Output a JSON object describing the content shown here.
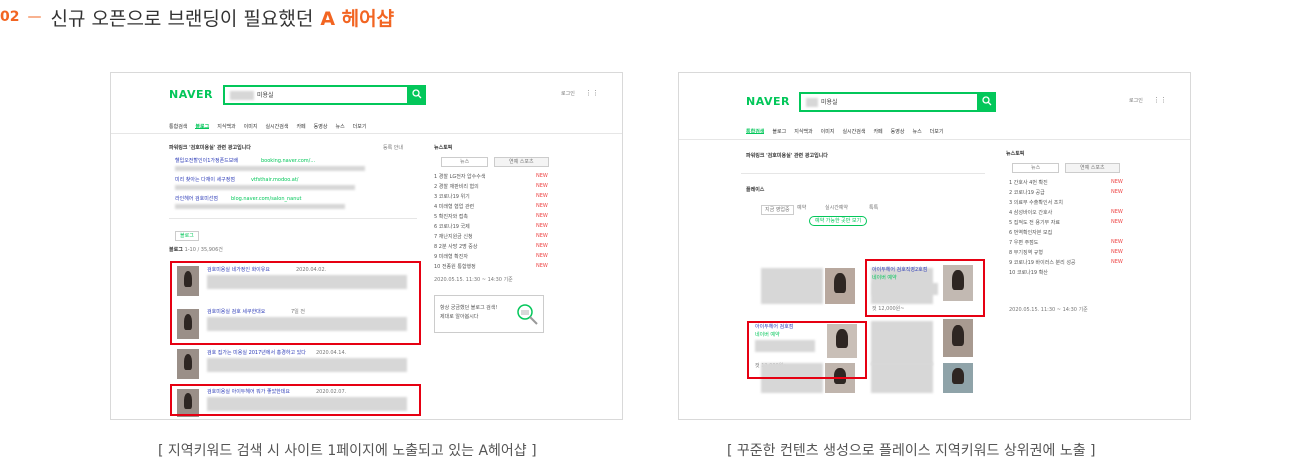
{
  "heading": {
    "number": "02",
    "dash": "—",
    "text": "신규 오픈으로 브랜딩이 필요했던",
    "accent": "A 헤어샵"
  },
  "captions": {
    "left": "[ 지역키워드 검색 시 사이트 1페이지에 노출되고 있는 A헤어샵 ]",
    "right": "[ 꾸준한 컨텐츠 생성으로 플레이스 지역키워드 상위권에 노출 ]"
  },
  "left_shot": {
    "logo": "NAVER",
    "query_suffix": "미용실",
    "tabs": [
      "통합검색",
      "블로그",
      "지식백과",
      "이미지",
      "실시간검색",
      "카페",
      "동영상",
      "뉴스",
      "더보기"
    ],
    "active_tab": "블로그",
    "ad_header": "파워링크 '검호미용실' 관련 광고입니다",
    "ads": [
      {
        "title": "헬입오전할인이1가정폰드보배",
        "url": "booking.naver.com/..."
      },
      {
        "title": "미리 찾아는 다재이 세구정점",
        "url": "vtfsthair.modoo.at/"
      },
      {
        "title": "라인헤어 검호미선점",
        "url": "blog.naver.com/salon_nanut"
      }
    ],
    "section_label": "블로그",
    "count_label": "1-10 / 35,906건",
    "posts": [
      {
        "title": "검호미용실 네가정인 화이유요",
        "date": "2020.04.02.",
        "badge": "4"
      },
      {
        "title": "검호미용실 검호 세쿠한대요",
        "date": "7일 전",
        "badge": "4"
      },
      {
        "title": "검호 집가는 미용실 2017년에서 홍경하고 있다",
        "date": "2020.04.14.",
        "badge": "4"
      },
      {
        "title": "검호미용실 아이두헤어 뭐가 좋았한데요",
        "date": "2020.02.07.",
        "badge": "4"
      }
    ],
    "news_header": "뉴스토픽",
    "news_tabs": [
      "뉴스",
      "연예 스포츠"
    ],
    "news": [
      "경찰 LG전자 압수수색",
      "경찰 재판비리 혐의",
      "코로나19 위기",
      "미래형 협업 관련",
      "확진자와 접촉",
      "코로나19 국제",
      "재난지원금 신청",
      "2분 사망 2명 중상",
      "미래형 확진자",
      "전종원 통합행정"
    ],
    "new_tag": "NEW",
    "promo_line1": "항상 궁금했던 블로그 검색!",
    "promo_line2": "제대로 알아봅시다"
  },
  "right_shot": {
    "logo": "NAVER",
    "query_suffix": "미용실",
    "tabs": [
      "통합검색",
      "블로그",
      "지식백과",
      "이미지",
      "실시간검색",
      "카페",
      "동영상",
      "뉴스",
      "더보기"
    ],
    "active_tab": "통합검색",
    "ad_header": "파워링크 '검호미용실' 관련 광고입니다",
    "place_label": "플레이스",
    "filters": [
      "지금 영업중",
      "예약",
      "실시간예약",
      "톡톡"
    ],
    "tooltip": "예약 가능한 곳만 보기",
    "places": [
      {
        "name": "아이두헤어 검호직영2호점",
        "meta": "네이버 예약",
        "price": "컷 12,000원~"
      },
      {
        "name": "아이두헤어 검호점",
        "meta": "네이버 예약",
        "price": "컷 12,000원~"
      }
    ],
    "news_header": "뉴스토픽",
    "news_tabs": [
      "뉴스",
      "연예 스포츠"
    ],
    "news": [
      "간호사 4번 확진",
      "코로나19 공급",
      "의료부 수출확인서 조치",
      "삼성바이오 간호사",
      "집적도 전 용기부 자료",
      "번역확인자본 모집",
      "우편 주점도",
      "무기징역 규형",
      "코로나19 바이러스 분리 성공",
      "코로나19 확산"
    ],
    "new_tag": "NEW"
  },
  "colors": {
    "accent_orange": "#f26522",
    "naver_green": "#03c75a",
    "highlight_red": "#e60012"
  },
  "icons": [
    "search-icon",
    "magnifier-icon",
    "grid-icon"
  ]
}
